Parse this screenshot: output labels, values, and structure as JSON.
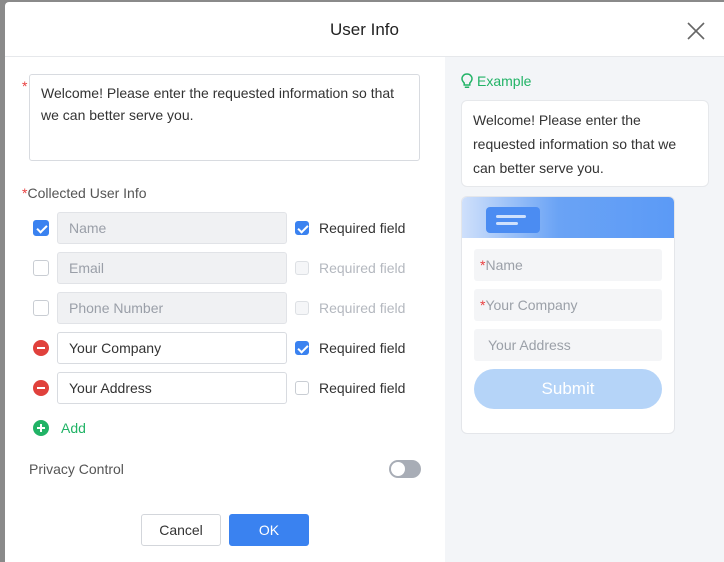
{
  "dialog": {
    "title": "User Info",
    "welcome_text": "Welcome! Please enter the requested information so that we can better serve you.",
    "collected_label": "Collected User Info",
    "fields": [
      {
        "name": "Name",
        "selected": true,
        "editable": false,
        "removable": false,
        "required_label": "Required field",
        "required": true,
        "required_enabled": true
      },
      {
        "name": "Email",
        "selected": false,
        "editable": false,
        "removable": false,
        "required_label": "Required field",
        "required": false,
        "required_enabled": false
      },
      {
        "name": "Phone Number",
        "selected": false,
        "editable": false,
        "removable": false,
        "required_label": "Required field",
        "required": false,
        "required_enabled": false
      },
      {
        "name": "Your Company",
        "selected": true,
        "editable": true,
        "removable": true,
        "required_label": "Required field",
        "required": true,
        "required_enabled": true
      },
      {
        "name": "Your Address",
        "selected": true,
        "editable": true,
        "removable": true,
        "required_label": "Required field",
        "required": false,
        "required_enabled": true
      }
    ],
    "add_label": "Add",
    "privacy_label": "Privacy Control",
    "privacy_on": false,
    "cancel_label": "Cancel",
    "ok_label": "OK"
  },
  "example": {
    "heading": "Example",
    "bubble_text": "Welcome! Please enter the requested information so that we can better serve you.",
    "form_fields": [
      {
        "label": "Name",
        "required": true
      },
      {
        "label": "Your Company",
        "required": true
      },
      {
        "label": "Your Address",
        "required": false
      }
    ],
    "submit_label": "Submit"
  },
  "colors": {
    "primary": "#3a82f0",
    "success": "#21b366",
    "danger": "#e0413c"
  },
  "icons": [
    "close-icon",
    "checkbox-icon",
    "minus-circle-icon",
    "plus-circle-icon",
    "lightbulb-icon",
    "form-header-icon"
  ]
}
